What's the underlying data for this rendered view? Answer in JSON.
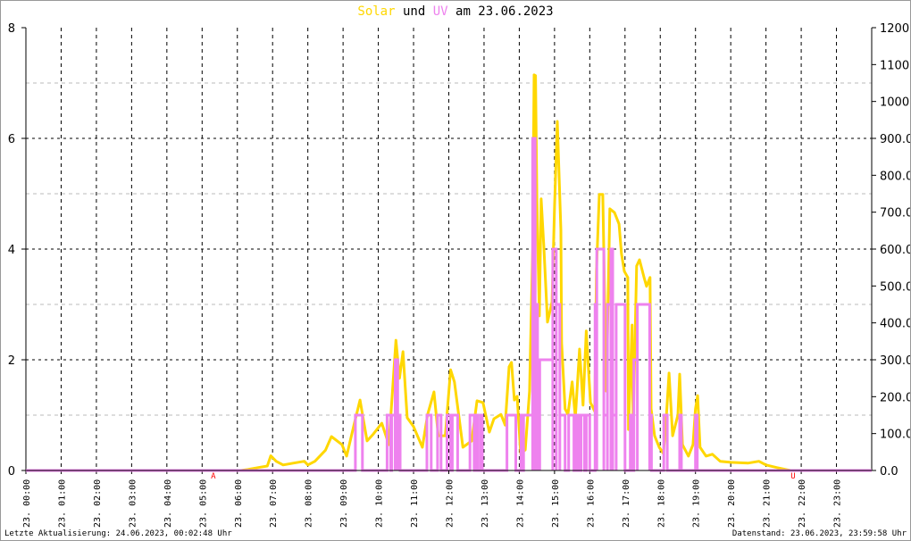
{
  "title": {
    "solar": "Solar",
    "und": "und",
    "uv": "UV",
    "rest": "am 23.06.2023"
  },
  "footer": {
    "left": "Letzte Aktualisierung: 24.06.2023, 00:02:48 Uhr",
    "right": "Datenstand: 23.06.2023, 23:59:58 Uhr"
  },
  "chart_data": {
    "type": "line",
    "title": "Solar und UV am 23.06.2023",
    "x_unit": "hour of day",
    "xlim": [
      0,
      24
    ],
    "x_tick_labels": [
      "23. 00:00",
      "23. 01:00",
      "23. 02:00",
      "23. 03:00",
      "23. 04:00",
      "23. 05:00",
      "23. 06:00",
      "23. 07:00",
      "23. 08:00",
      "23. 09:00",
      "23. 10:00",
      "23. 11:00",
      "23. 12:00",
      "23. 13:00",
      "23. 14:00",
      "23. 15:00",
      "23. 16:00",
      "23. 17:00",
      "23. 18:00",
      "23. 19:00",
      "23. 20:00",
      "23. 21:00",
      "23. 22:00",
      "23. 23:00"
    ],
    "left_axis": {
      "label": "UV",
      "ylim": [
        0,
        8
      ],
      "tick_labels": [
        "0",
        "2",
        "4",
        "6",
        "8"
      ]
    },
    "right_axis": {
      "label": "Solar",
      "ylim": [
        0,
        1200
      ],
      "tick_labels": [
        "0.0",
        "100.0",
        "200.0",
        "300.0",
        "400.0",
        "500.0",
        "600.0",
        "700.0",
        "800.0",
        "900.0",
        "1000",
        "1100",
        "1200"
      ]
    },
    "markers": [
      {
        "label": "A",
        "x": 5.25
      },
      {
        "label": "U",
        "x": 21.7
      }
    ],
    "colors": {
      "solar": "#ffd700",
      "uv": "#ee82ee",
      "marker": "#ff0000"
    },
    "series": [
      {
        "name": "Solar",
        "axis": "right",
        "points": [
          [
            0,
            0
          ],
          [
            6.1,
            0
          ],
          [
            6.3,
            3
          ],
          [
            6.6,
            8
          ],
          [
            6.85,
            12
          ],
          [
            6.95,
            40
          ],
          [
            7.1,
            25
          ],
          [
            7.3,
            15
          ],
          [
            7.6,
            20
          ],
          [
            7.9,
            25
          ],
          [
            8.0,
            15
          ],
          [
            8.2,
            25
          ],
          [
            8.5,
            55
          ],
          [
            8.67,
            92
          ],
          [
            8.97,
            70
          ],
          [
            9.1,
            39
          ],
          [
            9.3,
            120
          ],
          [
            9.48,
            191
          ],
          [
            9.68,
            80
          ],
          [
            9.86,
            99
          ],
          [
            10.1,
            128
          ],
          [
            10.3,
            70
          ],
          [
            10.5,
            353
          ],
          [
            10.6,
            250
          ],
          [
            10.7,
            322
          ],
          [
            10.82,
            143
          ],
          [
            11.0,
            119
          ],
          [
            11.25,
            63
          ],
          [
            11.4,
            152
          ],
          [
            11.58,
            213
          ],
          [
            11.7,
            94
          ],
          [
            11.9,
            94
          ],
          [
            12.05,
            273
          ],
          [
            12.16,
            240
          ],
          [
            12.4,
            63
          ],
          [
            12.65,
            80
          ],
          [
            12.8,
            189
          ],
          [
            12.97,
            184
          ],
          [
            13.15,
            104
          ],
          [
            13.28,
            140
          ],
          [
            13.48,
            152
          ],
          [
            13.6,
            123
          ],
          [
            13.71,
            281
          ],
          [
            13.78,
            293
          ],
          [
            13.86,
            191
          ],
          [
            13.94,
            201
          ],
          [
            14.04,
            46
          ],
          [
            14.17,
            56
          ],
          [
            14.29,
            215
          ],
          [
            14.38,
            600
          ],
          [
            14.42,
            1072
          ],
          [
            14.46,
            1070
          ],
          [
            14.5,
            733
          ],
          [
            14.57,
            419
          ],
          [
            14.62,
            736
          ],
          [
            14.7,
            603
          ],
          [
            14.8,
            402
          ],
          [
            14.93,
            457
          ],
          [
            15.0,
            716
          ],
          [
            15.08,
            946
          ],
          [
            15.18,
            651
          ],
          [
            15.2,
            346
          ],
          [
            15.3,
            167
          ],
          [
            15.38,
            152
          ],
          [
            15.5,
            240
          ],
          [
            15.59,
            143
          ],
          [
            15.71,
            329
          ],
          [
            15.81,
            177
          ],
          [
            15.9,
            378
          ],
          [
            16.02,
            184
          ],
          [
            16.14,
            160
          ],
          [
            16.19,
            540
          ],
          [
            16.27,
            748
          ],
          [
            16.37,
            748
          ],
          [
            16.47,
            215
          ],
          [
            16.57,
            709
          ],
          [
            16.7,
            699
          ],
          [
            16.83,
            668
          ],
          [
            16.9,
            588
          ],
          [
            16.98,
            540
          ],
          [
            17.08,
            523
          ],
          [
            17.1,
            111
          ],
          [
            17.2,
            394
          ],
          [
            17.23,
            119
          ],
          [
            17.33,
            554
          ],
          [
            17.41,
            571
          ],
          [
            17.54,
            523
          ],
          [
            17.61,
            499
          ],
          [
            17.71,
            523
          ],
          [
            17.74,
            167
          ],
          [
            17.84,
            94
          ],
          [
            17.97,
            63
          ],
          [
            18.09,
            46
          ],
          [
            18.17,
            143
          ],
          [
            18.25,
            264
          ],
          [
            18.35,
            94
          ],
          [
            18.5,
            150
          ],
          [
            18.55,
            261
          ],
          [
            18.63,
            70
          ],
          [
            18.8,
            39
          ],
          [
            18.93,
            70
          ],
          [
            19.0,
            167
          ],
          [
            19.06,
            203
          ],
          [
            19.13,
            63
          ],
          [
            19.3,
            39
          ],
          [
            19.48,
            44
          ],
          [
            19.7,
            25
          ],
          [
            20.0,
            22
          ],
          [
            20.5,
            20
          ],
          [
            20.8,
            25
          ],
          [
            21.0,
            15
          ],
          [
            21.3,
            8
          ],
          [
            21.6,
            2
          ],
          [
            21.7,
            0
          ],
          [
            24,
            0
          ]
        ]
      },
      {
        "name": "UV",
        "axis": "left",
        "steps": [
          [
            9.35,
            9.55,
            1
          ],
          [
            10.25,
            10.35,
            1
          ],
          [
            10.38,
            10.48,
            1
          ],
          [
            10.48,
            10.55,
            2
          ],
          [
            10.55,
            10.62,
            1
          ],
          [
            11.38,
            11.5,
            1
          ],
          [
            11.68,
            11.78,
            1
          ],
          [
            11.95,
            12.05,
            1
          ],
          [
            12.1,
            12.25,
            1
          ],
          [
            12.6,
            12.72,
            1
          ],
          [
            12.78,
            12.82,
            1
          ],
          [
            12.9,
            12.95,
            1
          ],
          [
            13.65,
            13.9,
            1
          ],
          [
            14.05,
            14.1,
            1
          ],
          [
            14.12,
            14.38,
            1
          ],
          [
            14.38,
            14.45,
            6
          ],
          [
            14.45,
            14.52,
            3
          ],
          [
            14.52,
            14.58,
            1
          ],
          [
            14.58,
            14.95,
            2
          ],
          [
            14.95,
            15.05,
            4
          ],
          [
            15.05,
            15.15,
            3
          ],
          [
            15.15,
            15.3,
            1
          ],
          [
            15.4,
            15.55,
            1
          ],
          [
            15.62,
            15.68,
            1
          ],
          [
            15.75,
            15.85,
            1
          ],
          [
            15.9,
            16.0,
            1
          ],
          [
            16.15,
            16.2,
            3
          ],
          [
            16.2,
            16.4,
            4
          ],
          [
            16.4,
            16.5,
            1
          ],
          [
            16.5,
            16.6,
            3
          ],
          [
            16.6,
            16.65,
            4
          ],
          [
            16.65,
            16.75,
            1
          ],
          [
            16.75,
            17.0,
            3
          ],
          [
            17.15,
            17.2,
            1
          ],
          [
            17.25,
            17.35,
            2
          ],
          [
            17.35,
            17.7,
            3
          ],
          [
            17.7,
            17.75,
            1
          ],
          [
            18.1,
            18.2,
            1
          ],
          [
            18.55,
            18.6,
            1
          ],
          [
            19.0,
            19.05,
            1
          ]
        ]
      }
    ]
  }
}
